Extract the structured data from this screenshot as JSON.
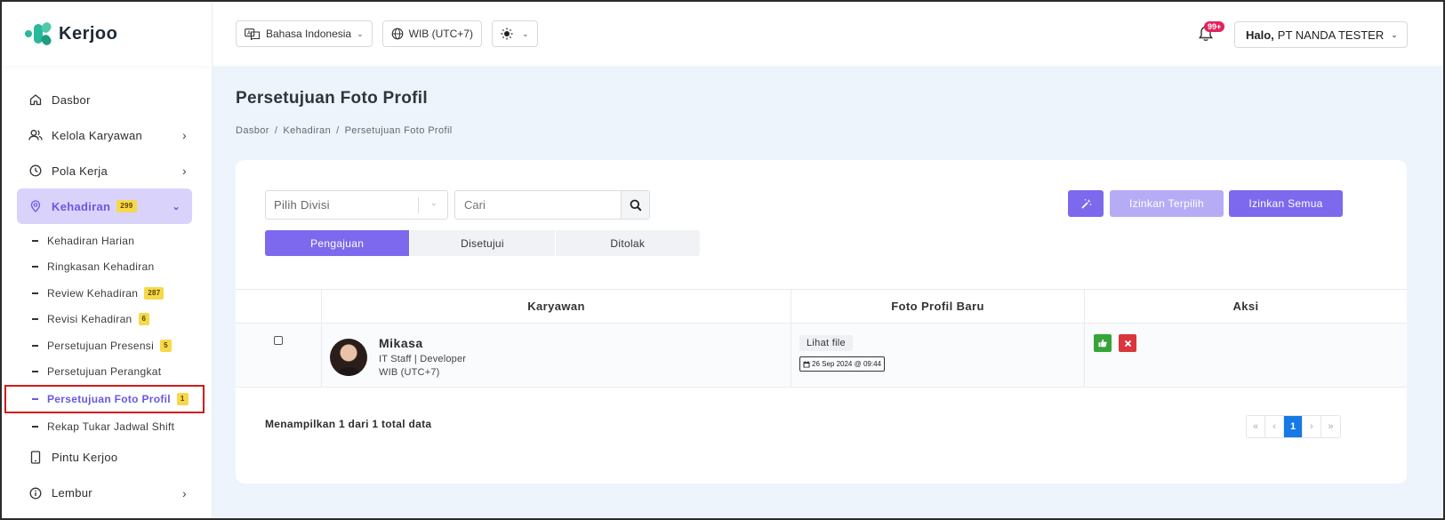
{
  "brand": {
    "name": "Kerjoo"
  },
  "topbar": {
    "language": "Bahasa Indonesia",
    "timezone": "WIB (UTC+7)",
    "notification_count": "99+",
    "greeting": "Halo,",
    "user_name": "PT NANDA TESTER"
  },
  "sidebar": {
    "items": [
      {
        "label": "Dasbor",
        "icon": "home-icon"
      },
      {
        "label": "Kelola Karyawan",
        "icon": "users-icon"
      },
      {
        "label": "Pola Kerja",
        "icon": "clock-icon"
      },
      {
        "label": "Kehadiran",
        "icon": "location-pin-icon",
        "badge": "299"
      },
      {
        "label": "Pintu Kerjoo",
        "icon": "tablet-icon"
      },
      {
        "label": "Lembur",
        "icon": "info-circle-icon"
      }
    ],
    "subitems": [
      {
        "label": "Kehadiran Harian"
      },
      {
        "label": "Ringkasan Kehadiran"
      },
      {
        "label": "Review Kehadiran",
        "badge": "287"
      },
      {
        "label": "Revisi Kehadiran",
        "badge": "6"
      },
      {
        "label": "Persetujuan Presensi",
        "badge": "5"
      },
      {
        "label": "Persetujuan Perangkat"
      },
      {
        "label": "Persetujuan Foto Profil",
        "badge": "1"
      },
      {
        "label": "Rekap Tukar Jadwal Shift"
      }
    ]
  },
  "page": {
    "title": "Persetujuan Foto Profil",
    "breadcrumb": [
      "Dasbor",
      "Kehadiran",
      "Persetujuan Foto Profil"
    ]
  },
  "filters": {
    "division_placeholder": "Pilih Divisi",
    "search_placeholder": "Cari"
  },
  "tabs": [
    "Pengajuan",
    "Disetujui",
    "Ditolak"
  ],
  "actions": {
    "approve_selected": "Izinkan Terpilih",
    "approve_all": "Izinkan Semua"
  },
  "table": {
    "headers": [
      "Karyawan",
      "Foto Profil Baru",
      "Aksi"
    ],
    "rows": [
      {
        "name": "Mikasa",
        "position": "IT Staff | Developer",
        "timezone": "WIB (UTC+7)",
        "file_link": "Lihat file",
        "date": "26 Sep 2024 @ 09:44"
      }
    ]
  },
  "footer": {
    "summary": "Menampilkan 1 dari 1 total data",
    "pagination": {
      "first": "«",
      "prev": "‹",
      "current": "1",
      "next": "›",
      "last": "»"
    }
  },
  "colors": {
    "accent": "#7c69ee",
    "accent_light": "#b6acf6",
    "badge": "#f7d84a",
    "approve": "#35a53a",
    "reject": "#d9363e",
    "pagination_active": "#1579e6",
    "highlight_border": "#d11c1c"
  }
}
